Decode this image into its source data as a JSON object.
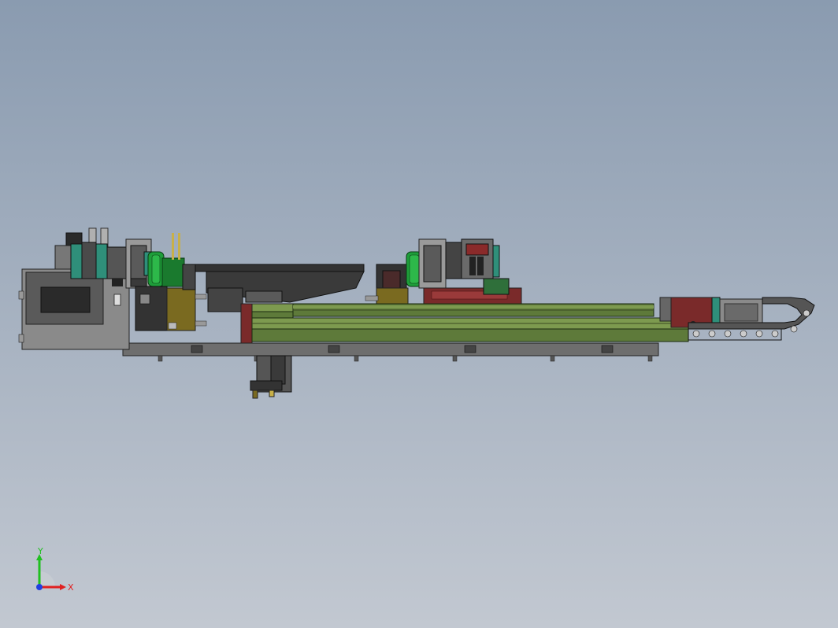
{
  "colors": {
    "background_top": "#8a9bb0",
    "background_bottom": "#c2c8d1",
    "rail_green": "#5e7a3a",
    "rail_green_light": "#7d9a4f",
    "dark_metal": "#3a3a3a",
    "grey_metal": "#8c8c8c",
    "teal": "#2f8f7a",
    "bright_green": "#2db84a",
    "maroon": "#7a2a2a",
    "olive": "#7a6a20"
  },
  "triad": {
    "x_label": "X",
    "y_label": "Y",
    "x_color": "#e02020",
    "y_color": "#20c020",
    "z_color": "#2040e0"
  }
}
